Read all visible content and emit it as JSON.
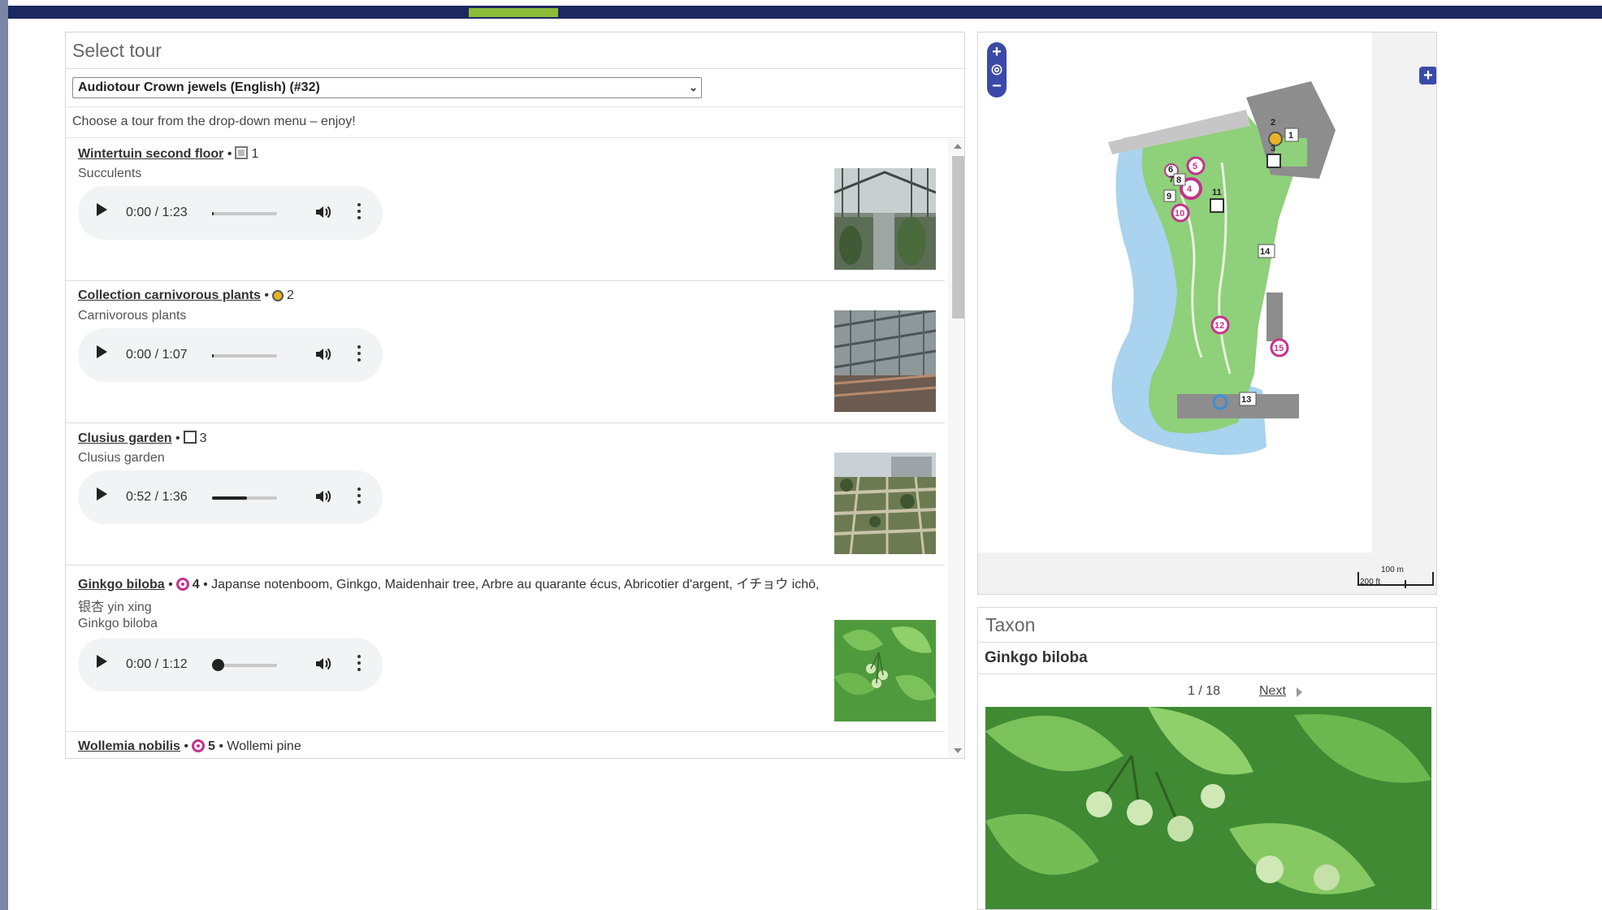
{
  "tour_panel": {
    "title": "Select tour",
    "selected_tour": "Audiotour Crown jewels (English) (#32)",
    "hint": "Choose a tour from the drop-down menu – enjoy!"
  },
  "items": [
    {
      "name": "Wintertuin second floor",
      "sep": "•",
      "symbol": "gray-square",
      "number": "1",
      "extra": "",
      "subtitle": "Succulents",
      "audio": {
        "time": "0:00 / 1:23",
        "progress": 0.0
      },
      "thumb": "greenhouse-succulents-photo"
    },
    {
      "name": "Collection carnivorous plants",
      "sep": "•",
      "symbol": "yellow-circle",
      "number": "2",
      "extra": "",
      "subtitle": "Carnivorous plants",
      "audio": {
        "time": "0:00 / 1:07",
        "progress": 0.0
      },
      "thumb": "greenhouse-roof-photo"
    },
    {
      "name": "Clusius garden",
      "sep": "•",
      "symbol": "square",
      "number": "3",
      "extra": "",
      "subtitle": "Clusius garden",
      "audio": {
        "time": "0:52 / 1:36",
        "progress": 0.54
      },
      "thumb": "garden-beds-photo"
    },
    {
      "name": "Ginkgo biloba",
      "sep": "•",
      "symbol": "pink-target",
      "number": "4",
      "extra": "• Japanse notenboom, Ginkgo, Maidenhair tree, Arbre au quarante écus, Abricotier d'argent, イチョウ ichō,",
      "extra2": "银杏 yin xing",
      "subtitle": "Ginkgo biloba",
      "audio": {
        "time": "0:00 / 1:12",
        "progress": 0.0,
        "knob": true
      },
      "thumb": "ginkgo-leaves-photo"
    },
    {
      "name": "Wollemia nobilis",
      "sep": "•",
      "symbol": "pink-target",
      "number": "5",
      "extra": "• Wollemi pine",
      "subtitle": "",
      "audio": null,
      "thumb": ""
    }
  ],
  "map": {
    "markers": [
      "1",
      "2",
      "3",
      "4",
      "5",
      "6",
      "7",
      "8",
      "9",
      "10",
      "11",
      "12",
      "13",
      "14",
      "15"
    ],
    "scale_metric": "100 m",
    "scale_imperial": "200 ft",
    "colors": {
      "water": "#a9d3ee",
      "grass": "#8fd07a",
      "building": "#8d8d8d",
      "marker": "#c5328a"
    }
  },
  "taxon_panel": {
    "title": "Taxon",
    "name": "Ginkgo biloba",
    "page": "1 / 18",
    "next_label": "Next"
  },
  "colors": {
    "accent": "#8cbc3a",
    "topbar": "#1d2760",
    "zoom": "#3b4aa8"
  }
}
